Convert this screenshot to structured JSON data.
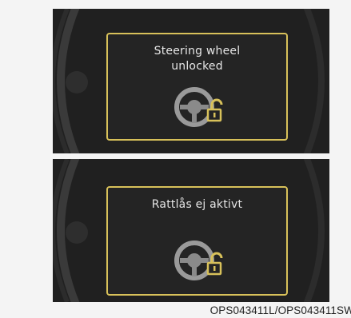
{
  "screens": [
    {
      "message_lines": [
        "Steering wheel",
        "unlocked"
      ],
      "icon": "steering-wheel-unlocked-icon"
    },
    {
      "message_lines": [
        "Rattlås ej aktivt"
      ],
      "icon": "steering-wheel-unlocked-icon"
    }
  ],
  "caption": "OPS043411L/OPS043411SW",
  "colors": {
    "panel_bg": "#202020",
    "frame_border": "#d8c15a",
    "text": "#e6e6e6",
    "lock_icon": "#d8c15a"
  }
}
